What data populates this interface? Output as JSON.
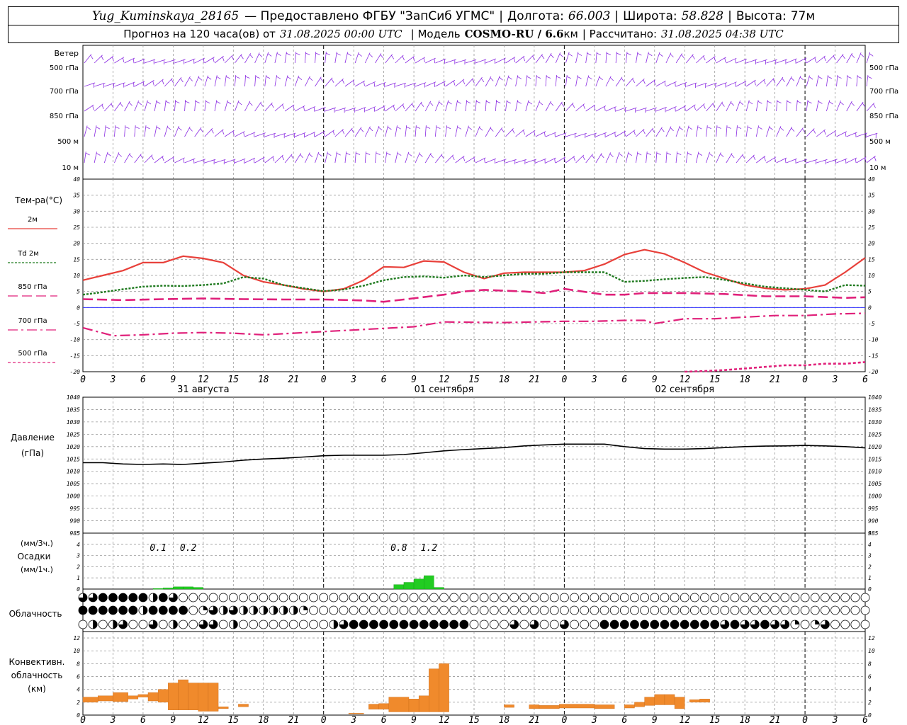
{
  "header": {
    "station": "Yug_Kuminskaya_28165",
    "provider": "— Предоставлено ФГБУ \"ЗапСиб УГМС\"",
    "lon_label": "Долгота:",
    "lon_value": "66.003",
    "lat_label": "Широта:",
    "lat_value": "58.828",
    "alt_label": "Высота:",
    "alt_value": "77м",
    "forecast_label": "Прогноз на 120 часа(ов) от",
    "forecast_start": "31.08.2025 00:00 UTC",
    "model_label": "| Модель",
    "model_value": "COSMO-RU / 6.6",
    "model_unit": "км",
    "calc_label": "| Рассчитано:",
    "calc_value": "31.08.2025 04:38 UTC"
  },
  "colors": {
    "t2m": "#e8403a",
    "td2m": "#1f7a1f",
    "t850": "#e0207a",
    "t700": "#e0207a",
    "t500": "#e0207a",
    "barb": "#8a2be2",
    "precip": "#22cc22",
    "conv": "#f08a2c",
    "pressure": "#000000",
    "zero_line": "#3030ff"
  },
  "chart_data": [
    {
      "type": "wind_barbs",
      "title": "Ветер",
      "levels": [
        "500 гПа",
        "700 гПа",
        "850 гПа",
        "500 м",
        "10 м"
      ]
    },
    {
      "type": "line",
      "title": "Тем-ра(°С)",
      "ylim": [
        -20,
        40
      ],
      "yticks": [
        40,
        35,
        30,
        25,
        20,
        15,
        10,
        5,
        0,
        -5,
        -10,
        -15,
        -20
      ],
      "x_hours": [
        0,
        3,
        6,
        9,
        12,
        15,
        18,
        21,
        24,
        27,
        30,
        33,
        36,
        39,
        42,
        45,
        48,
        51,
        54,
        57,
        60,
        63,
        66,
        69,
        72,
        75,
        78
      ],
      "x_tick_labels": [
        "0",
        "3",
        "6",
        "9",
        "12",
        "15",
        "18",
        "21",
        "0",
        "3",
        "6",
        "9",
        "12",
        "15",
        "18",
        "21",
        "0",
        "3",
        "6",
        "9",
        "12",
        "15",
        "18",
        "21",
        "0",
        "3",
        "6"
      ],
      "date_labels": [
        "31 августа",
        "01 сентября",
        "02 сентября"
      ],
      "series": [
        {
          "name": "2м",
          "style": "solid",
          "x": [
            0,
            2,
            4,
            6,
            8,
            10,
            12,
            14,
            16,
            18,
            20,
            22,
            24,
            26,
            28,
            30,
            32,
            34,
            36,
            38,
            40,
            42,
            44,
            46,
            48,
            50,
            52,
            54,
            56,
            58,
            60,
            62,
            64,
            66,
            68,
            70,
            72,
            74,
            76,
            78
          ],
          "y": [
            8.5,
            10,
            11.5,
            14,
            14,
            16,
            15.3,
            14,
            10,
            8,
            7,
            5.8,
            5,
            5.8,
            8.5,
            12.7,
            12.5,
            14.5,
            14.2,
            11,
            9,
            10.7,
            11,
            11,
            11,
            11.5,
            13.5,
            16.5,
            18,
            16.7,
            14,
            11,
            9,
            7,
            6,
            5.5,
            5.8,
            7,
            11,
            15.5
          ]
        },
        {
          "name": "Td 2м",
          "style": "dotted",
          "x": [
            0,
            2,
            4,
            6,
            8,
            10,
            12,
            14,
            16,
            18,
            20,
            22,
            24,
            26,
            28,
            30,
            32,
            34,
            36,
            38,
            40,
            42,
            44,
            46,
            48,
            50,
            52,
            54,
            56,
            58,
            60,
            62,
            64,
            66,
            68,
            70,
            72,
            74,
            76,
            78
          ],
          "y": [
            4,
            4.8,
            5.7,
            6.5,
            6.8,
            6.7,
            7,
            7.5,
            9.5,
            9,
            7,
            6,
            5.1,
            5.6,
            6.8,
            8.5,
            9.5,
            9.7,
            9.3,
            10,
            9.5,
            10,
            10.5,
            10.5,
            11,
            11,
            11,
            8,
            8.3,
            8.8,
            9.2,
            9.5,
            8.6,
            7.5,
            6.5,
            6,
            5.5,
            5,
            7,
            6.8
          ]
        },
        {
          "name": "850 гПа",
          "style": "dashed",
          "x": [
            0,
            4,
            8,
            12,
            16,
            20,
            24,
            28,
            30,
            32,
            36,
            38,
            40,
            44,
            46,
            48,
            52,
            54,
            56,
            60,
            64,
            68,
            72,
            76,
            78
          ],
          "y": [
            2.6,
            2.3,
            2.6,
            2.8,
            2.6,
            2.5,
            2.5,
            2.2,
            1.8,
            2.5,
            4,
            5,
            5.5,
            5,
            4.5,
            5.8,
            4,
            4,
            4.5,
            4.5,
            4.2,
            3.5,
            3.5,
            3,
            3.2
          ]
        },
        {
          "name": "700 гПа",
          "style": "dashdot",
          "x": [
            0,
            3,
            6,
            9,
            12,
            15,
            18,
            21,
            24,
            27,
            30,
            33,
            36,
            39,
            42,
            45,
            48,
            51,
            54,
            56,
            57,
            60,
            63,
            66,
            69,
            72,
            75,
            78
          ],
          "y": [
            -6.3,
            -8.8,
            -8.5,
            -8,
            -7.8,
            -8,
            -8.5,
            -8,
            -7.5,
            -7,
            -6.5,
            -6,
            -4.5,
            -4.6,
            -4.7,
            -4.5,
            -4.3,
            -4.3,
            -4,
            -4,
            -5,
            -3.5,
            -3.5,
            -3,
            -2.5,
            -2.5,
            -2,
            -1.8
          ]
        },
        {
          "name": "500 гПа",
          "style": "densedash",
          "x": [
            60,
            62,
            64,
            66,
            68,
            70,
            72,
            74,
            76,
            78
          ],
          "y": [
            -20,
            -19.8,
            -19.5,
            -19,
            -18.5,
            -18,
            -18,
            -17.5,
            -17.5,
            -17
          ]
        }
      ]
    },
    {
      "type": "line",
      "title": "Давление",
      "ylabel": "(гПа)",
      "ylim": [
        985,
        1040
      ],
      "yticks": [
        1040,
        1035,
        1030,
        1025,
        1020,
        1015,
        1010,
        1005,
        1000,
        995,
        990,
        985
      ],
      "series": [
        {
          "name": "Давление",
          "x": [
            0,
            2,
            4,
            6,
            8,
            10,
            12,
            14,
            16,
            18,
            20,
            22,
            24,
            26,
            28,
            30,
            32,
            34,
            36,
            38,
            40,
            42,
            44,
            46,
            48,
            50,
            52,
            54,
            56,
            58,
            60,
            62,
            64,
            66,
            68,
            70,
            72,
            74,
            76,
            78
          ],
          "y": [
            1013.5,
            1013.5,
            1013,
            1012.8,
            1013,
            1012.8,
            1013.3,
            1013.8,
            1014.5,
            1015,
            1015.3,
            1015.8,
            1016.3,
            1016.5,
            1016.5,
            1016.5,
            1016.8,
            1017.5,
            1018.3,
            1018.8,
            1019.2,
            1019.6,
            1020.3,
            1020.7,
            1021,
            1021,
            1021,
            1020,
            1019.2,
            1019,
            1019,
            1019.2,
            1019.6,
            1020,
            1020.2,
            1020.3,
            1020.5,
            1020.3,
            1020,
            1019.5
          ]
        }
      ]
    },
    {
      "type": "bar",
      "title": "Осадки",
      "ylabel_top": "(мм/3ч.)",
      "ylabel_bottom": "(мм/1ч.)",
      "ylim": [
        0,
        5
      ],
      "yticks": [
        5,
        4,
        3,
        2,
        1,
        0
      ],
      "annotations": [
        {
          "x": 7.5,
          "text": "0.1"
        },
        {
          "x": 10.5,
          "text": "0.2"
        },
        {
          "x": 31.5,
          "text": "0.8"
        },
        {
          "x": 34.5,
          "text": "1.2"
        }
      ],
      "bars": [
        {
          "x0": 7,
          "x1": 8,
          "y": 0.05
        },
        {
          "x0": 8,
          "x1": 9,
          "y": 0.1
        },
        {
          "x0": 9,
          "x1": 10,
          "y": 0.2
        },
        {
          "x0": 10,
          "x1": 11,
          "y": 0.2
        },
        {
          "x0": 11,
          "x1": 12,
          "y": 0.15
        },
        {
          "x0": 31,
          "x1": 32,
          "y": 0.4
        },
        {
          "x0": 32,
          "x1": 33,
          "y": 0.6
        },
        {
          "x0": 33,
          "x1": 34,
          "y": 0.9
        },
        {
          "x0": 34,
          "x1": 35,
          "y": 1.2
        },
        {
          "x0": 35,
          "x1": 36,
          "y": 0.15
        }
      ]
    },
    {
      "type": "table",
      "title": "Облачность",
      "rows_eighths": [
        [
          6,
          6,
          8,
          8,
          8,
          8,
          8,
          4,
          8,
          6,
          0,
          0,
          0,
          0,
          0,
          0,
          0,
          0,
          0,
          0,
          0,
          0,
          0,
          0,
          0,
          0,
          0,
          0,
          0,
          0,
          0,
          0,
          0,
          0,
          0,
          0,
          0,
          0,
          0,
          0,
          0,
          0,
          0,
          0,
          0,
          0,
          0,
          0,
          0,
          0,
          0,
          0,
          0,
          0,
          0,
          0,
          0,
          0,
          0,
          0,
          0,
          0,
          0,
          0,
          0,
          0,
          0,
          0,
          0,
          0,
          0,
          0,
          0,
          0,
          0,
          0,
          0,
          0,
          0
        ],
        [
          8,
          8,
          8,
          8,
          8,
          8,
          4,
          8,
          8,
          8,
          8,
          0,
          2,
          6,
          4,
          6,
          4,
          4,
          4,
          4,
          4,
          4,
          2,
          0,
          0,
          0,
          0,
          0,
          0,
          0,
          0,
          0,
          0,
          0,
          0,
          0,
          0,
          0,
          0,
          0,
          0,
          0,
          0,
          0,
          0,
          0,
          0,
          0,
          0,
          0,
          0,
          0,
          0,
          0,
          0,
          0,
          0,
          0,
          0,
          0,
          0,
          0,
          0,
          0,
          0,
          0,
          0,
          0,
          0,
          0,
          0,
          0,
          0,
          0,
          0,
          0,
          0,
          0,
          0
        ],
        [
          0,
          4,
          0,
          4,
          6,
          0,
          0,
          6,
          0,
          4,
          0,
          0,
          6,
          6,
          0,
          4,
          0,
          0,
          0,
          0,
          0,
          0,
          0,
          0,
          0,
          4,
          6,
          8,
          8,
          8,
          8,
          8,
          8,
          8,
          8,
          8,
          8,
          8,
          8,
          0,
          0,
          0,
          0,
          6,
          0,
          6,
          0,
          0,
          6,
          0,
          0,
          0,
          8,
          8,
          8,
          8,
          8,
          8,
          8,
          8,
          8,
          8,
          8,
          8,
          6,
          8,
          6,
          6,
          8,
          6,
          6,
          2,
          0,
          2,
          6,
          0,
          0,
          0,
          0
        ]
      ]
    },
    {
      "type": "bar",
      "title": "Конвективн.",
      "ylabel_mid": "облачность",
      "ylabel_bottom": "(км)",
      "ylim": [
        0,
        13
      ],
      "yticks": [
        12,
        10,
        8,
        6,
        4,
        2,
        0
      ],
      "bars": [
        {
          "x0": 0,
          "x1": 1.5,
          "y0": 2,
          "y1": 2.8
        },
        {
          "x0": 1.5,
          "x1": 3,
          "y0": 2.2,
          "y1": 3
        },
        {
          "x0": 3,
          "x1": 4.5,
          "y0": 2.1,
          "y1": 3.5
        },
        {
          "x0": 4.5,
          "x1": 5.5,
          "y0": 2.5,
          "y1": 3
        },
        {
          "x0": 5.5,
          "x1": 6.5,
          "y0": 2.8,
          "y1": 3.2
        },
        {
          "x0": 6.5,
          "x1": 7.5,
          "y0": 2.2,
          "y1": 3.5
        },
        {
          "x0": 7.5,
          "x1": 8.5,
          "y0": 2,
          "y1": 4
        },
        {
          "x0": 8.5,
          "x1": 9.5,
          "y0": 0.8,
          "y1": 5
        },
        {
          "x0": 9.5,
          "x1": 10.5,
          "y0": 0.8,
          "y1": 5.5
        },
        {
          "x0": 10.5,
          "x1": 11.5,
          "y0": 0.8,
          "y1": 5
        },
        {
          "x0": 11.5,
          "x1": 12.5,
          "y0": 0.6,
          "y1": 5
        },
        {
          "x0": 12.5,
          "x1": 13.5,
          "y0": 0.6,
          "y1": 5
        },
        {
          "x0": 13.5,
          "x1": 14.5,
          "y0": 1,
          "y1": 1.3
        },
        {
          "x0": 15.5,
          "x1": 16.5,
          "y0": 1.3,
          "y1": 1.7
        },
        {
          "x0": 26.5,
          "x1": 28,
          "y0": 0.2,
          "y1": 0.3
        },
        {
          "x0": 28.5,
          "x1": 29.5,
          "y0": 0.9,
          "y1": 1.7
        },
        {
          "x0": 29.5,
          "x1": 30.5,
          "y0": 0.9,
          "y1": 1.8
        },
        {
          "x0": 30.5,
          "x1": 32.5,
          "y0": 0.5,
          "y1": 2.8
        },
        {
          "x0": 32.5,
          "x1": 33.5,
          "y0": 0.5,
          "y1": 2.5
        },
        {
          "x0": 33.5,
          "x1": 34.5,
          "y0": 0.5,
          "y1": 3
        },
        {
          "x0": 34.5,
          "x1": 35.5,
          "y0": 0.5,
          "y1": 7.2
        },
        {
          "x0": 35.5,
          "x1": 36.5,
          "y0": 0.5,
          "y1": 8
        },
        {
          "x0": 42,
          "x1": 43,
          "y0": 1.2,
          "y1": 1.6
        },
        {
          "x0": 44.5,
          "x1": 45.5,
          "y0": 1,
          "y1": 1.6
        },
        {
          "x0": 45.5,
          "x1": 47.5,
          "y0": 1,
          "y1": 1.5
        },
        {
          "x0": 47.5,
          "x1": 51,
          "y0": 1.1,
          "y1": 1.7
        },
        {
          "x0": 51,
          "x1": 53,
          "y0": 1,
          "y1": 1.6
        },
        {
          "x0": 54,
          "x1": 55,
          "y0": 1.1,
          "y1": 1.6
        },
        {
          "x0": 55,
          "x1": 56,
          "y0": 1.3,
          "y1": 2
        },
        {
          "x0": 56,
          "x1": 57,
          "y0": 1.5,
          "y1": 2.8
        },
        {
          "x0": 57,
          "x1": 58,
          "y0": 1.6,
          "y1": 3.2
        },
        {
          "x0": 58,
          "x1": 59,
          "y0": 1.6,
          "y1": 3.2
        },
        {
          "x0": 59,
          "x1": 60,
          "y0": 1,
          "y1": 2.8
        },
        {
          "x0": 60.5,
          "x1": 61.5,
          "y0": 2,
          "y1": 2.4
        },
        {
          "x0": 61.5,
          "x1": 62.5,
          "y0": 2,
          "y1": 2.5
        }
      ]
    }
  ]
}
